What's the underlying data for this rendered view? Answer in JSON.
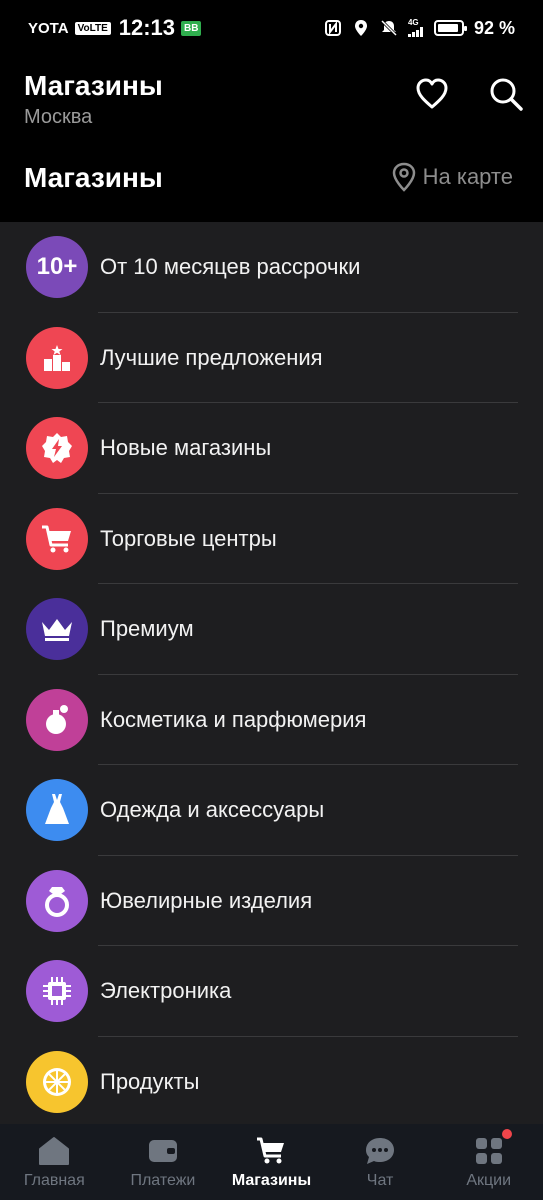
{
  "status_bar": {
    "carrier": "YOTA",
    "volte": "VoLTE",
    "time": "12:13",
    "vb": "BB",
    "network": "4G",
    "battery_percent": "92 %",
    "battery_level": 0.92
  },
  "header": {
    "title": "Магазины",
    "city": "Москва",
    "favorites_icon": "heart-icon",
    "search_icon": "search-icon"
  },
  "section": {
    "title": "Магазины",
    "map_link": "На карте"
  },
  "categories": [
    {
      "label": "От 10 месяцев рассрочки",
      "icon": "ten-plus-icon",
      "icon_text": "10+",
      "color": "#7b4ab8"
    },
    {
      "label": "Лучшие предложения",
      "icon": "podium-icon",
      "color": "#ef4653"
    },
    {
      "label": "Новые магазины",
      "icon": "new-badge-icon",
      "color": "#ef4653"
    },
    {
      "label": "Торговые центры",
      "icon": "cart-icon",
      "color": "#ef4653"
    },
    {
      "label": "Премиум",
      "icon": "crown-icon",
      "color": "#4a2f9a"
    },
    {
      "label": "Косметика и парфюмерия",
      "icon": "perfume-icon",
      "color": "#c04098"
    },
    {
      "label": "Одежда и аксессуары",
      "icon": "dress-icon",
      "color": "#3d8cf0"
    },
    {
      "label": "Ювелирные изделия",
      "icon": "ring-icon",
      "color": "#9e5bd6"
    },
    {
      "label": "Электроника",
      "icon": "chip-icon",
      "color": "#9e5bd6"
    },
    {
      "label": "Продукты",
      "icon": "lemon-icon",
      "color": "#f7c52e"
    }
  ],
  "tabs": [
    {
      "label": "Главная",
      "icon": "home-icon",
      "active": false
    },
    {
      "label": "Платежи",
      "icon": "wallet-icon",
      "active": false
    },
    {
      "label": "Магазины",
      "icon": "cart-icon",
      "active": true
    },
    {
      "label": "Чат",
      "icon": "chat-icon",
      "active": false
    },
    {
      "label": "Акции",
      "icon": "grid-icon",
      "active": false,
      "notification": true
    }
  ]
}
